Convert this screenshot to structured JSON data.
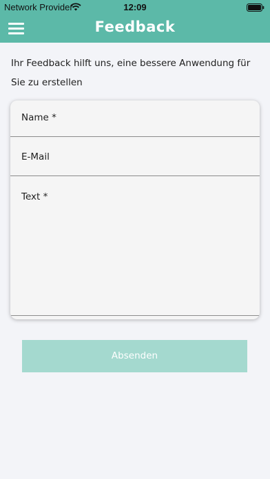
{
  "status_bar": {
    "carrier": "Network Provider",
    "time": "12:09",
    "wifi_icon": "wifi-icon",
    "battery_icon": "battery-icon"
  },
  "nav": {
    "title": "Feedback",
    "menu_icon": "hamburger-menu-icon"
  },
  "intro_text": "Ihr Feedback hilft uns, eine bessere Anwendung für Sie zu erstellen",
  "form": {
    "name_label": "Name *",
    "email_label": "E-Mail",
    "text_label": "Text *"
  },
  "submit_label": "Absenden",
  "colors": {
    "accent": "#5cb9a8",
    "button_disabled": "#a4d9cf",
    "background": "#f3f4f8",
    "field_background": "#f5f5f5"
  }
}
